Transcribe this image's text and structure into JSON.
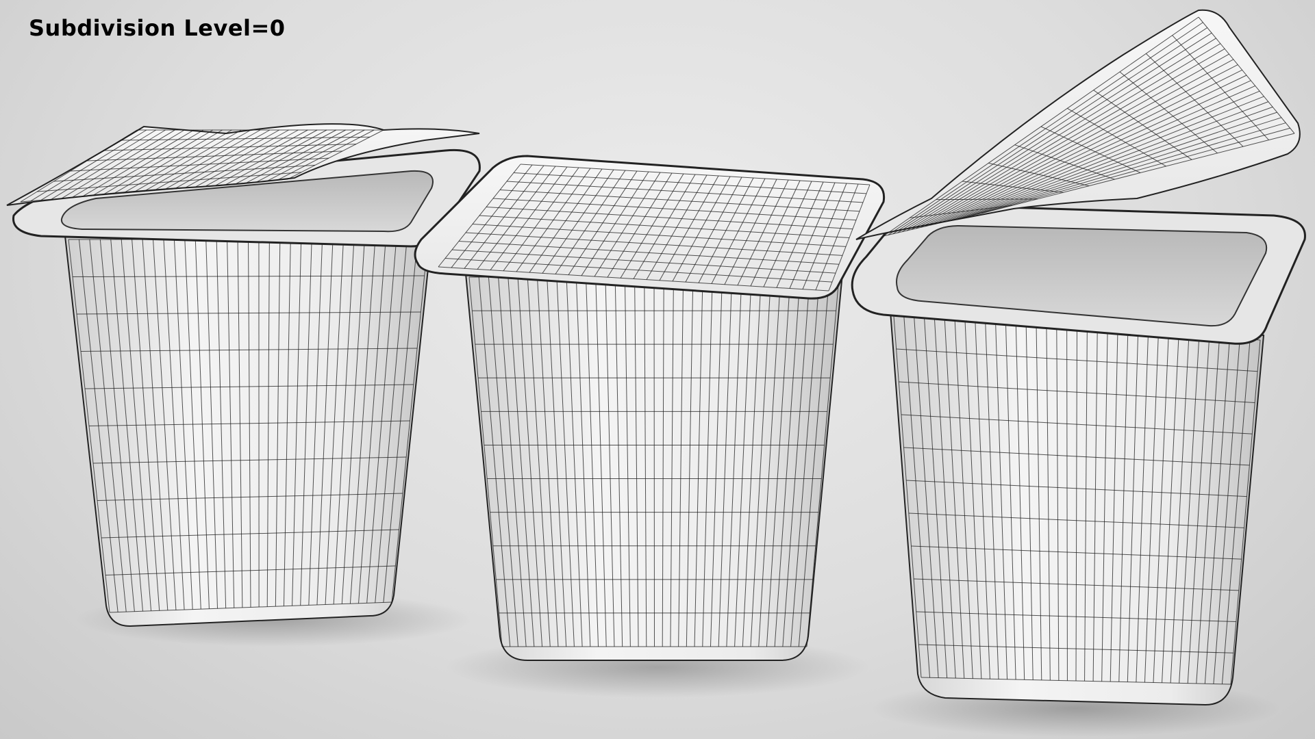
{
  "overlay": {
    "label": "Subdivision Level=0"
  },
  "scene": {
    "objects": [
      {
        "name": "yogurt-cup-left",
        "lid_state": "partially-open"
      },
      {
        "name": "yogurt-cup-center",
        "lid_state": "closed"
      },
      {
        "name": "yogurt-cup-right",
        "lid_state": "peeled-back"
      }
    ],
    "colors": {
      "background": "#dcdcdc",
      "surface": "#f2f2f2",
      "wire": "#1a1a1a"
    }
  }
}
